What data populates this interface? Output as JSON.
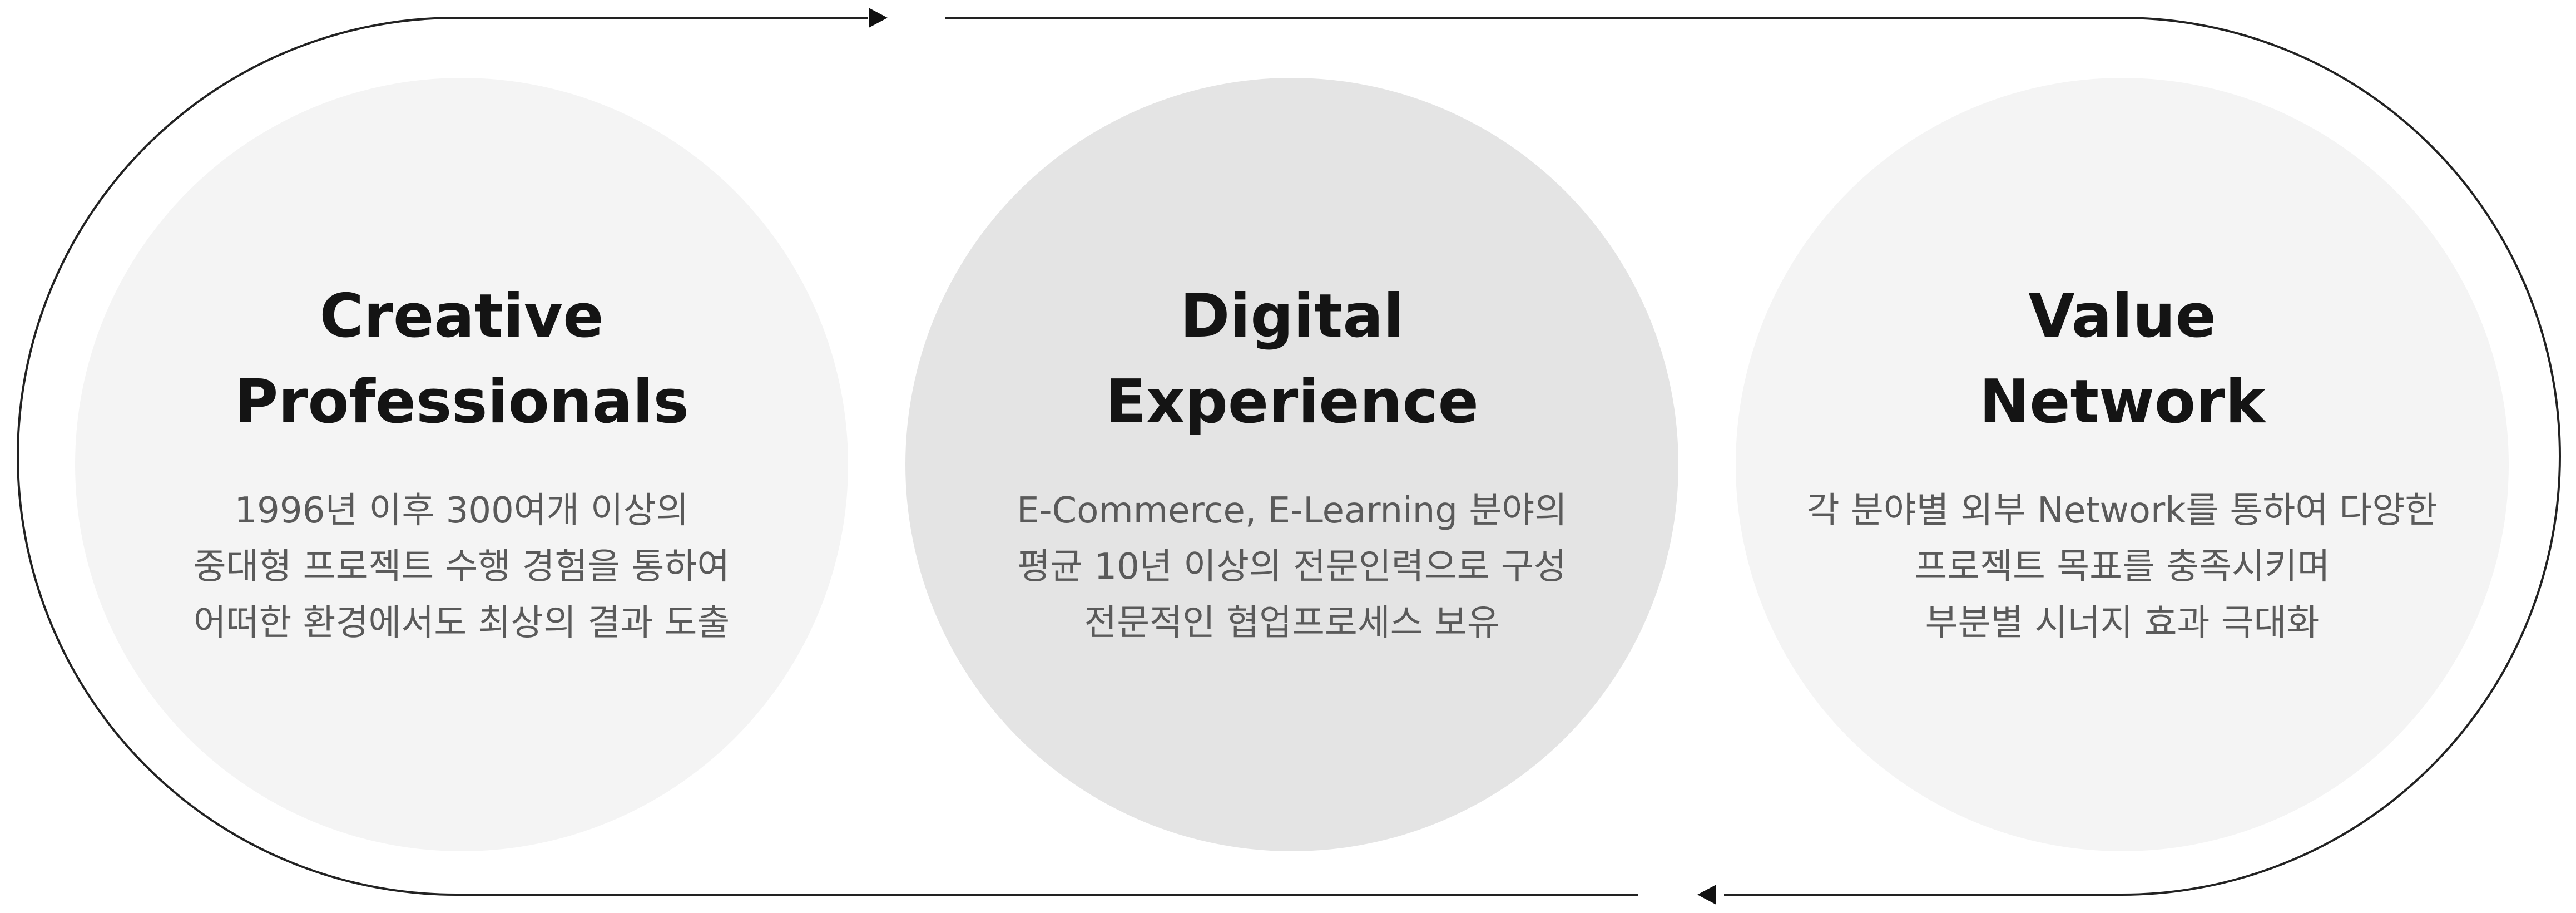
{
  "items": [
    {
      "title_lines": [
        "Creative",
        "Professionals"
      ],
      "desc_lines": [
        "1996년 이후 300여개 이상의",
        "중대형 프로젝트 수행 경험을 통하여",
        "어떠한 환경에서도 최상의 결과 도출"
      ]
    },
    {
      "title_lines": [
        "Digital",
        "Experience"
      ],
      "desc_lines": [
        "E-Commerce, E-Learning 분야의",
        "평균 10년 이상의 전문인력으로 구성",
        "전문적인 협업프로세스 보유"
      ]
    },
    {
      "title_lines": [
        "Value",
        "Network"
      ],
      "desc_lines": [
        "각 분야별 외부 Network를 통하여 다양한",
        "프로젝트 목표를 충족시키며",
        "부분별 시너지 효과 극대화"
      ]
    }
  ],
  "colors": {
    "circle_light": "#f4f4f4",
    "circle_mid": "#e4e4e4",
    "title": "#141414",
    "desc": "#5a5a5a",
    "track_line": "#222222"
  },
  "icons": [
    "arrow-right-icon",
    "arrow-left-icon"
  ]
}
